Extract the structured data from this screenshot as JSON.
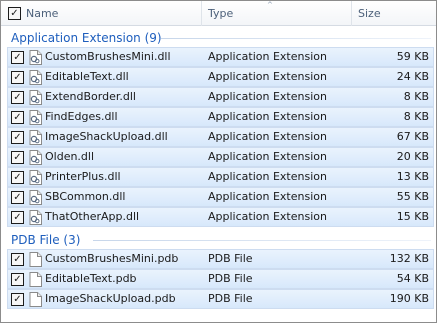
{
  "columns": {
    "name": "Name",
    "type": "Type",
    "size": "Size"
  },
  "groups": [
    {
      "label": "Application Extension (9)",
      "items": [
        {
          "name": "CustomBrushesMini.dll",
          "type": "Application Extension",
          "size": "59 KB",
          "checked": true
        },
        {
          "name": "EditableText.dll",
          "type": "Application Extension",
          "size": "24 KB",
          "checked": true
        },
        {
          "name": "ExtendBorder.dll",
          "type": "Application Extension",
          "size": "8 KB",
          "checked": true
        },
        {
          "name": "FindEdges.dll",
          "type": "Application Extension",
          "size": "8 KB",
          "checked": true
        },
        {
          "name": "ImageShackUpload.dll",
          "type": "Application Extension",
          "size": "67 KB",
          "checked": true
        },
        {
          "name": "Olden.dll",
          "type": "Application Extension",
          "size": "20 KB",
          "checked": true
        },
        {
          "name": "PrinterPlus.dll",
          "type": "Application Extension",
          "size": "13 KB",
          "checked": true
        },
        {
          "name": "SBCommon.dll",
          "type": "Application Extension",
          "size": "55 KB",
          "checked": true
        },
        {
          "name": "ThatOtherApp.dll",
          "type": "Application Extension",
          "size": "15 KB",
          "checked": true
        }
      ]
    },
    {
      "label": "PDB File (3)",
      "items": [
        {
          "name": "CustomBrushesMini.pdb",
          "type": "PDB File",
          "size": "132 KB",
          "checked": true
        },
        {
          "name": "EditableText.pdb",
          "type": "PDB File",
          "size": "54 KB",
          "checked": true
        },
        {
          "name": "ImageShackUpload.pdb",
          "type": "PDB File",
          "size": "190 KB",
          "checked": true
        }
      ]
    }
  ],
  "header_checkbox_checked": true,
  "sort_indicator": "ascending",
  "colors": {
    "group_label": "#1e5ebd",
    "selection": "#d7e8fb"
  }
}
